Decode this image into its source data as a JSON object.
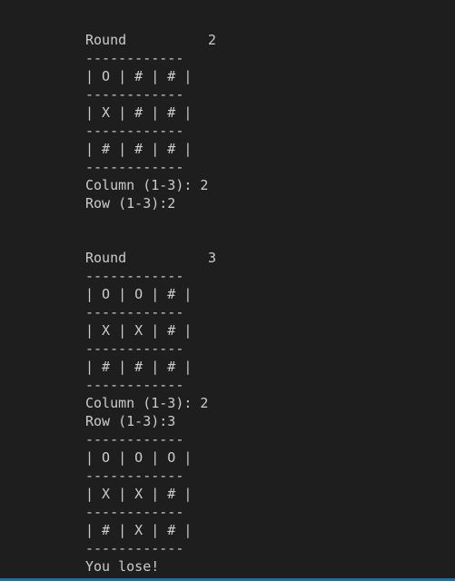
{
  "terminal": {
    "separator": "------------",
    "blocks": [
      {
        "round_label": "Round",
        "round_number": "2",
        "board_rows": [
          "| O | # | # |",
          "| X | # | # |",
          "| # | # | # |"
        ],
        "column_prompt": "Column (1-3): 2",
        "row_prompt": "Row (1-3):2"
      },
      {
        "round_label": "Round",
        "round_number": "3",
        "board_rows": [
          "| O | O | # |",
          "| X | X | # |",
          "| # | # | # |"
        ],
        "column_prompt": "Column (1-3): 2",
        "row_prompt": "Row (1-3):3"
      }
    ],
    "final_board_rows": [
      "| O | O | O |",
      "| X | X | # |",
      "| # | X | # |"
    ],
    "result": "You lose!"
  },
  "colors": {
    "background": "#1e1e1e",
    "text": "#cccccc",
    "status_bar": "#007acc"
  }
}
